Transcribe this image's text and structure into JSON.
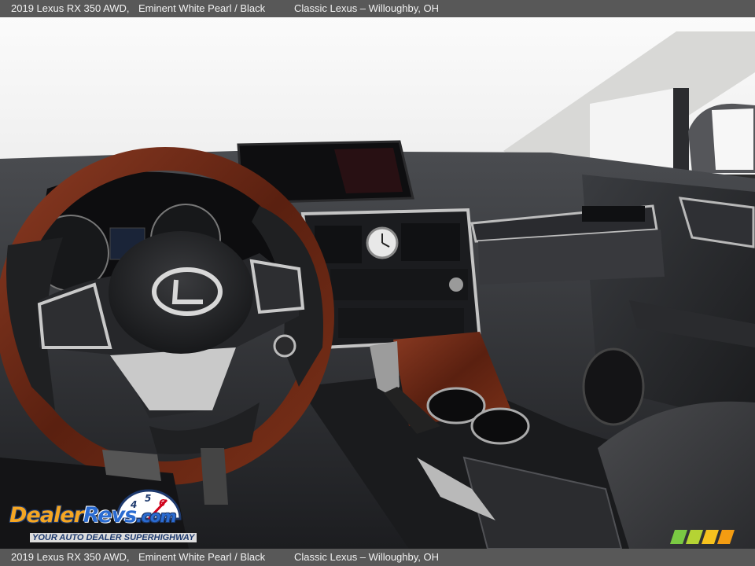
{
  "caption": {
    "vehicle": "2019 Lexus RX 350 AWD,",
    "colors": "Eminent White Pearl / Black",
    "dealer": "Classic Lexus – Willoughby, OH"
  },
  "watermark": {
    "brand_a": "Dealer",
    "brand_b": "Revs",
    "brand_c": ".com",
    "tagline": "YOUR AUTO DEALER SUPERHIGHWAY",
    "gauge_digits": [
      "4",
      "5",
      "6"
    ]
  },
  "photo": {
    "subject": "car-interior-dashboard",
    "icons": [
      "steering-wheel-icon",
      "lexus-emblem-icon",
      "analog-clock-icon",
      "gear-shifter-icon"
    ]
  },
  "colors": {
    "bar_bg": "#585858",
    "bar_text": "#f2f2f2",
    "wood": "#6a2a18",
    "leather": "#1f2022",
    "silver": "#c9c9c9",
    "watermark_orange": "#f5a623",
    "watermark_blue": "#2a6bd1"
  }
}
